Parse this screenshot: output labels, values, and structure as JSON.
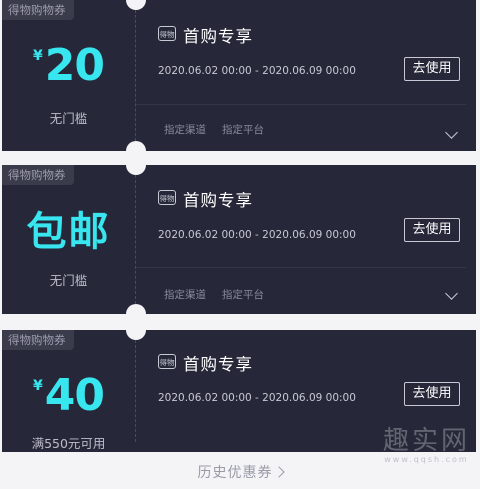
{
  "coupons": [
    {
      "tag": "得物购物券",
      "currency": "¥",
      "amount": "20",
      "condition": "无门槛",
      "logo": "得物",
      "title": "首购专享",
      "dates": "2020.06.02 00:00 - 2020.06.09 00:00",
      "button": "去使用",
      "channel": "指定渠道",
      "platform": "指定平台"
    },
    {
      "tag": "得物购物券",
      "amount": "包邮",
      "condition": "无门槛",
      "logo": "得物",
      "title": "首购专享",
      "dates": "2020.06.02 00:00 - 2020.06.09 00:00",
      "button": "去使用",
      "channel": "指定渠道",
      "platform": "指定平台"
    },
    {
      "tag": "得物购物券",
      "currency": "¥",
      "amount": "40",
      "condition": "满550元可用",
      "logo": "得物",
      "title": "首购专享",
      "dates": "2020.06.02 00:00 - 2020.06.09 00:00",
      "button": "去使用"
    }
  ],
  "history_link": "历史优惠券",
  "watermark": {
    "main": "趣实网",
    "sub": "www.qqsh.com"
  },
  "colors": {
    "card_bg": "#262839",
    "accent": "#37e6ee",
    "page_bg": "#f4f4f6"
  }
}
